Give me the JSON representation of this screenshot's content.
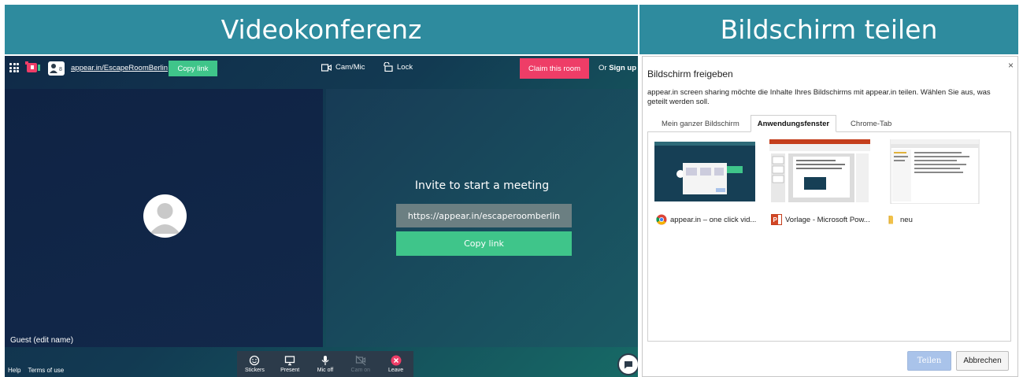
{
  "banners": {
    "left": "Videokonferenz",
    "right": "Bildschirm teilen"
  },
  "app": {
    "room_link": "appear.in/EscapeRoomBerlin",
    "copy_link_top": "Copy link",
    "cam_mic": "Cam/Mic",
    "lock": "Lock",
    "claim": "Claim this room",
    "or": "Or",
    "signup": "Sign up",
    "people_count": "8",
    "guest": "Guest (edit name)",
    "invite_title": "Invite to start a meeting",
    "invite_url": "https://appear.in/escaperoomberlin",
    "invite_copy": "Copy link",
    "footer": {
      "help": "Help",
      "terms": "Terms of use"
    },
    "toolbar": [
      {
        "id": "stickers",
        "label": "Stickers",
        "icon": "smiley-icon"
      },
      {
        "id": "present",
        "label": "Present",
        "icon": "monitor-icon"
      },
      {
        "id": "mic",
        "label": "Mic off",
        "icon": "mic-icon"
      },
      {
        "id": "cam",
        "label": "Cam on",
        "icon": "camera-off-icon"
      },
      {
        "id": "leave",
        "label": "Leave",
        "icon": "close-circle-icon"
      }
    ]
  },
  "dialog": {
    "title": "Bildschirm freigeben",
    "description": "appear.in screen sharing möchte die Inhalte Ihres Bildschirms mit appear.in teilen. Wählen Sie aus, was geteilt werden soll.",
    "tabs": [
      "Mein ganzer Bildschirm",
      "Anwendungsfenster",
      "Chrome-Tab"
    ],
    "active_tab": "Anwendungsfenster",
    "windows": [
      {
        "label": "appear.in – one click vid...",
        "icon": "chrome-icon"
      },
      {
        "label": "Vorlage - Microsoft Pow...",
        "icon": "powerpoint-icon"
      },
      {
        "label": "neu",
        "icon": "folder-icon"
      }
    ],
    "share_button": "Teilen",
    "cancel_button": "Abbrechen",
    "close": "×"
  },
  "colors": {
    "banner": "#2e8b9e",
    "accent_green": "#3fc58a",
    "claim_red": "#ee3d67",
    "share_blue": "#a9c3ea"
  }
}
